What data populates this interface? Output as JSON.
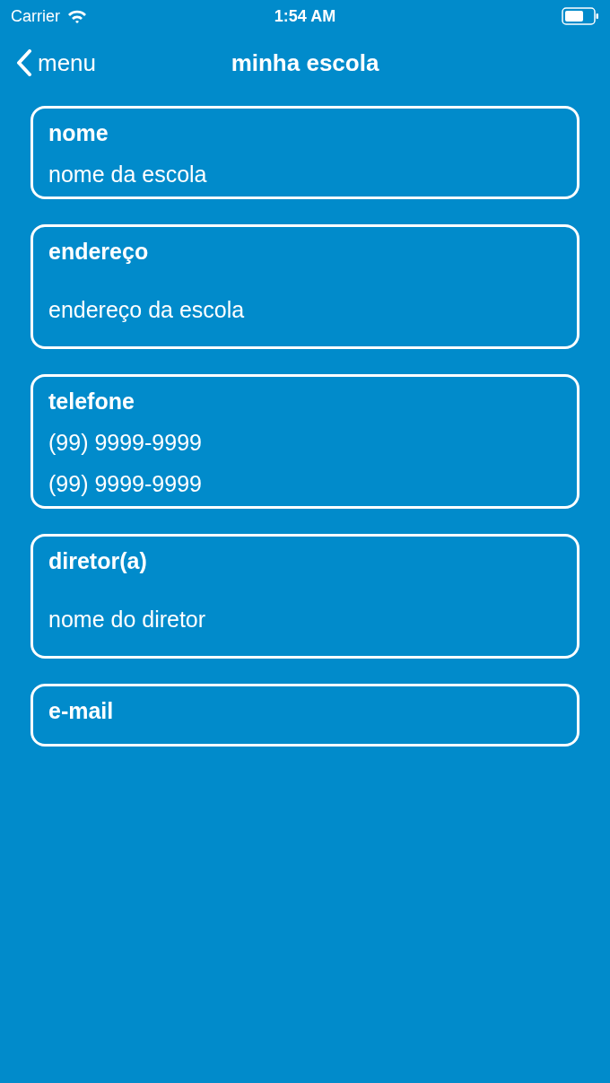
{
  "status_bar": {
    "carrier": "Carrier",
    "time": "1:54 AM"
  },
  "nav": {
    "back_label": "menu",
    "title": "minha escola"
  },
  "cards": [
    {
      "kind": "compact",
      "label": "nome",
      "values": [
        "nome da escola"
      ]
    },
    {
      "kind": "spacious",
      "label": "endereço",
      "values": [
        "endereço da escola"
      ]
    },
    {
      "kind": "compact",
      "label": "telefone",
      "values": [
        "(99) 9999-9999",
        "(99) 9999-9999"
      ]
    },
    {
      "kind": "spacious",
      "label": "diretor(a)",
      "values": [
        "nome do diretor"
      ]
    },
    {
      "kind": "compact",
      "label": "e-mail"
    }
  ]
}
